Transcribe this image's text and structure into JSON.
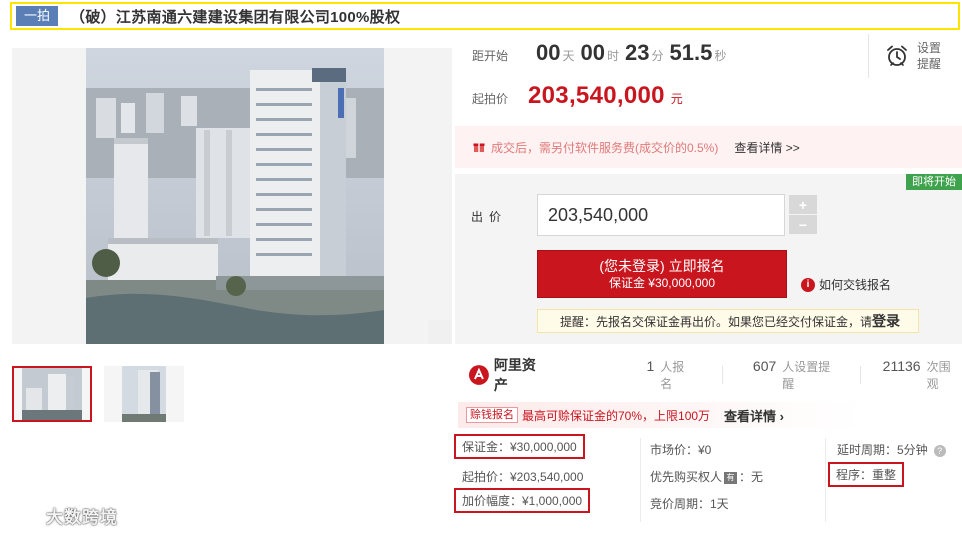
{
  "title": {
    "badge": "一拍",
    "text": "（破）江苏南通六建建设集团有限公司100%股权"
  },
  "countdown": {
    "label": "距开始",
    "days": "00",
    "days_unit": "天",
    "hours": "00",
    "hours_unit": "时",
    "minutes": "23",
    "minutes_unit": "分",
    "seconds": "51.5",
    "seconds_unit": "秒"
  },
  "reminder": {
    "label": "设置提醒",
    "icon": "alarm-clock-icon"
  },
  "start_price": {
    "label": "起拍价",
    "value": "203,540,000",
    "unit": "元"
  },
  "fee_notice": {
    "icon": "gift-icon",
    "text": "成交后，需另付软件服务费(成交价的0.5%)",
    "link": "查看详情 >>"
  },
  "bid": {
    "status_tag": "即将开始",
    "label": "出价",
    "input_value": "203,540,000",
    "plus": "+",
    "minus": "−",
    "signup_main": "(您未登录) 立即报名",
    "signup_sub": "保证金 ¥30,000,000",
    "how_icon": "i",
    "how_link": "如何交钱报名",
    "tip_text": "提醒：先报名交保证金再出价。如果您已经交付保证金，请",
    "tip_login": "登录"
  },
  "stats": {
    "brand": "阿里资产",
    "signups_num": "1",
    "signups_label": "人报名",
    "reminders_num": "607",
    "reminders_label": "人设置提醒",
    "views_num": "21136",
    "views_label": "次围观"
  },
  "promo": {
    "tag": "赊钱报名",
    "text": "最高可赊保证金的70%，上限100万",
    "link": "查看详情 ›"
  },
  "info": {
    "deposit": "保证金：¥30,000,000",
    "start_price": "起拍价：¥203,540,000",
    "increment": "加价幅度：¥1,000,000",
    "market_price": "市场价：¥0",
    "priority_prefix": "优先购买权人",
    "priority_icon": "有",
    "priority_suffix": "：无",
    "cycle": "竞价周期：1天",
    "delay": "延时周期：5分钟",
    "help_icon": "?",
    "procedure": "程序：重整"
  },
  "watermark": "大数跨境",
  "colors": {
    "accent": "#c9151e",
    "title_highlight": "#ffe400",
    "status_green": "#3fa24c",
    "badge_blue": "#5a7fb6"
  }
}
